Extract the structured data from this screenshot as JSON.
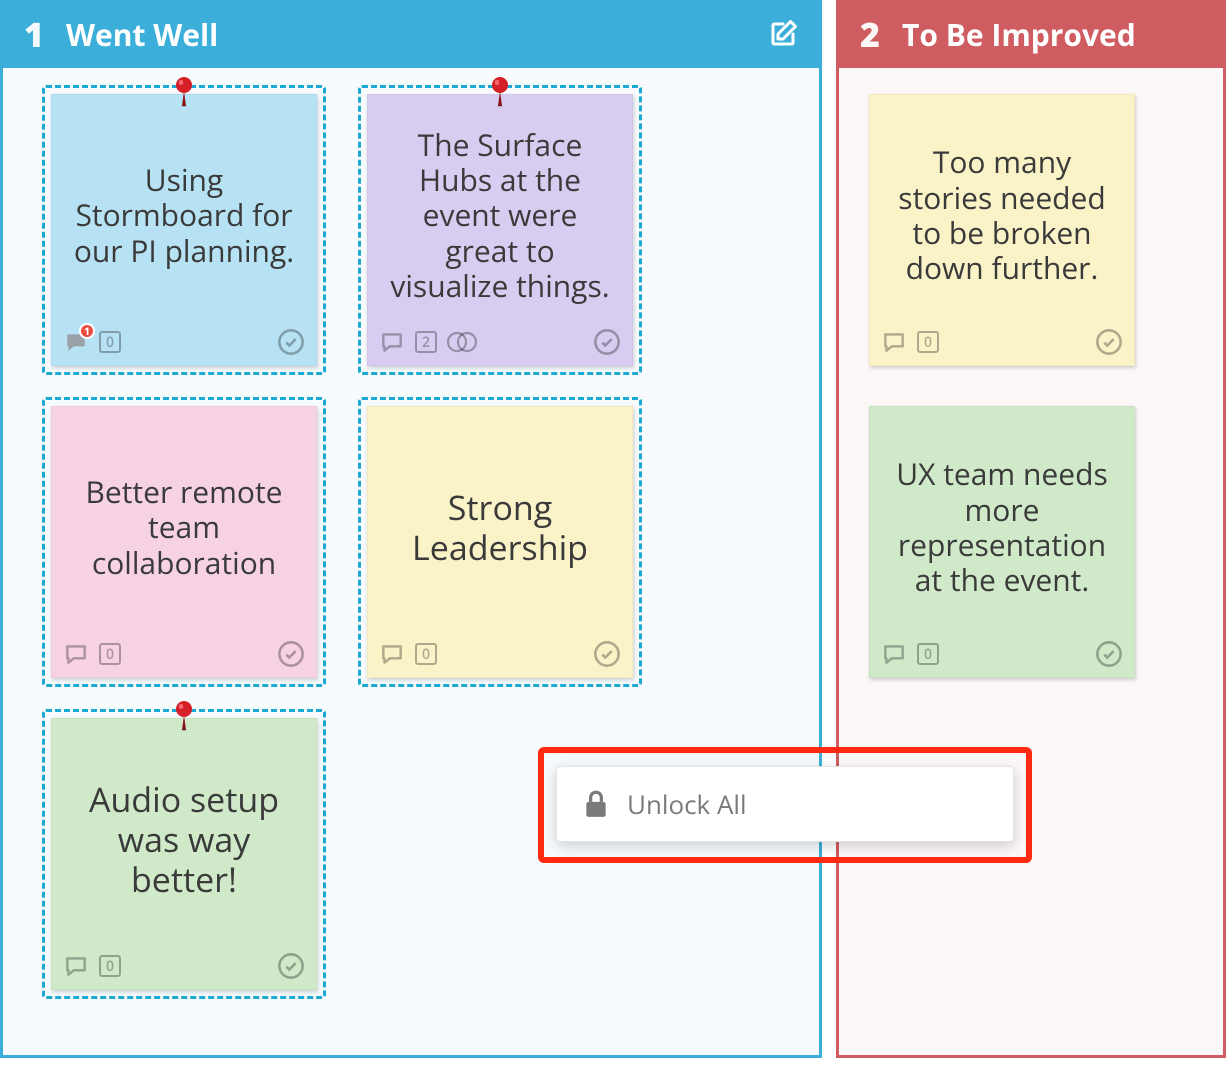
{
  "columns": [
    {
      "number": "1",
      "title": "Went Well",
      "color": "blue",
      "editable": true,
      "cards": [
        {
          "text": "Using Stormboard for our PI planning.",
          "color": "blue",
          "selected": true,
          "pinned": true,
          "comment_badge": "1",
          "count": "0",
          "reaction": false,
          "big": false
        },
        {
          "text": "The Surface Hubs at the event were great to visualize things.",
          "color": "purple",
          "selected": true,
          "pinned": true,
          "comment_badge": null,
          "count": "2",
          "reaction": true,
          "big": false
        },
        {
          "text": "Better remote team collaboration",
          "color": "pink",
          "selected": true,
          "pinned": false,
          "comment_badge": null,
          "count": "0",
          "reaction": false,
          "big": false
        },
        {
          "text": "Strong Leadership",
          "color": "yellow",
          "selected": true,
          "pinned": false,
          "comment_badge": null,
          "count": "0",
          "reaction": false,
          "big": true
        },
        {
          "text": "Audio setup was way better!",
          "color": "green",
          "selected": true,
          "pinned": true,
          "comment_badge": null,
          "count": "0",
          "reaction": false,
          "big": true
        }
      ]
    },
    {
      "number": "2",
      "title": "To Be Improved",
      "color": "red",
      "editable": false,
      "cards": [
        {
          "text": "Too many stories needed to be broken down further.",
          "color": "yellow",
          "selected": false,
          "pinned": false,
          "comment_badge": null,
          "count": "0",
          "reaction": false,
          "big": false
        },
        {
          "text": "UX team needs more representation at the event.",
          "color": "green",
          "selected": false,
          "pinned": false,
          "comment_badge": null,
          "count": "0",
          "reaction": false,
          "big": false
        }
      ]
    }
  ],
  "context_menu": {
    "label": "Unlock All"
  }
}
